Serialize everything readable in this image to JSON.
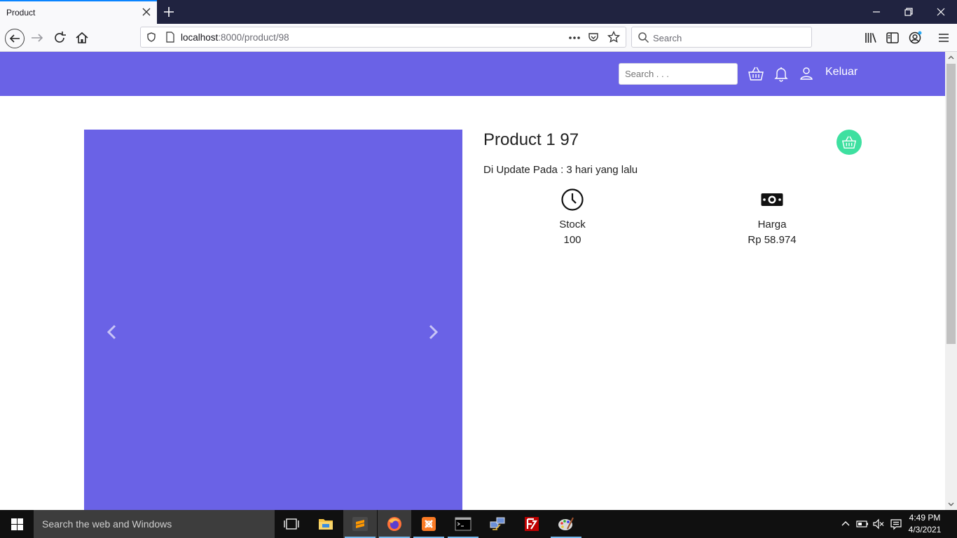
{
  "browser": {
    "tab_title": "Product",
    "url_host": "localhost",
    "url_rest": ":8000/product/98",
    "search_placeholder": "Search"
  },
  "header": {
    "search_placeholder": "Search . . .",
    "logout_label": "Keluar",
    "bg_color": "#6a62e6"
  },
  "product": {
    "title": "Product 1 97",
    "updated": "Di Update Pada : 3 hari yang lalu",
    "stock_label": "Stock",
    "stock_value": "100",
    "price_label": "Harga",
    "price_value": "Rp 58.974",
    "cart_button_color": "#3ee0a0"
  },
  "taskbar": {
    "search_placeholder": "Search the web and Windows",
    "time": "4:49 PM",
    "date": "4/3/2021"
  }
}
